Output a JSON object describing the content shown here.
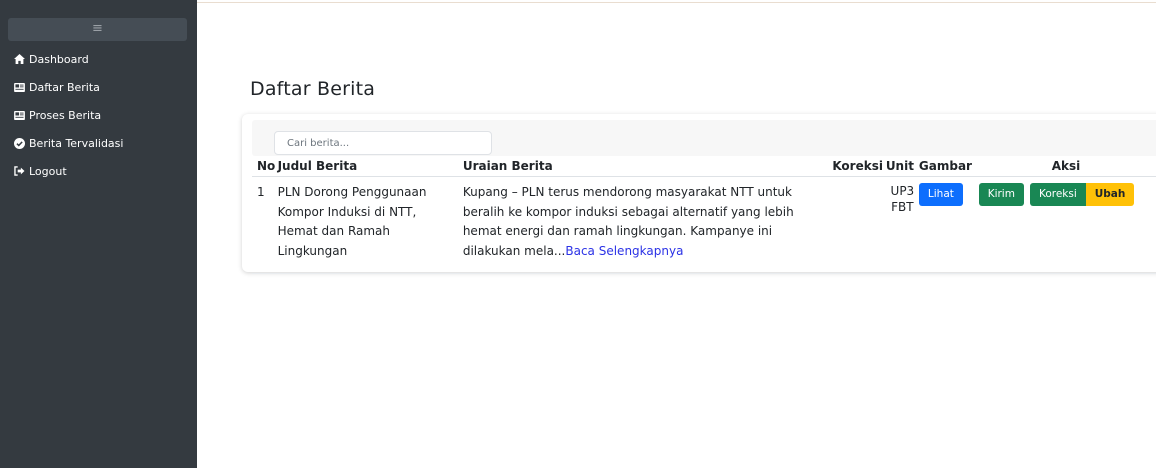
{
  "sidebar": {
    "toggle_label": "≡",
    "items": [
      {
        "label": "Dashboard",
        "icon": "home-icon"
      },
      {
        "label": "Daftar Berita",
        "icon": "newspaper-icon"
      },
      {
        "label": "Proses Berita",
        "icon": "newspaper-icon"
      },
      {
        "label": "Berita Tervalidasi",
        "icon": "check-circle-icon"
      },
      {
        "label": "Logout",
        "icon": "logout-icon"
      }
    ]
  },
  "main": {
    "title": "Daftar Berita",
    "search": {
      "placeholder": "Cari berita...",
      "value": ""
    },
    "table": {
      "headers": [
        "No",
        "Judul Berita",
        "Uraian Berita",
        "Koreksi",
        "Unit",
        "Gambar",
        "Aksi"
      ],
      "rows": [
        {
          "no": "1",
          "judul": "PLN Dorong Penggunaan Kompor Induksi di NTT, Hemat dan Ramah Lingkungan",
          "uraian": "Kupang – PLN terus mendorong masyarakat NTT untuk beralih ke kompor induksi sebagai alternatif yang lebih hemat energi dan ramah lingkungan. Kampanye ini dilakukan mela...",
          "read_more": "Baca Selengkapnya",
          "koreksi": "",
          "unit": "UP3 FBT",
          "gambar_button": "Lihat",
          "actions": [
            "Kirim",
            "Koreksi",
            "Ubah"
          ]
        }
      ]
    }
  },
  "colors": {
    "sidebar_bg": "#343a40",
    "primary": "#0d6efd",
    "success": "#198754",
    "warning": "#ffc107",
    "link": "#2b32e6"
  }
}
